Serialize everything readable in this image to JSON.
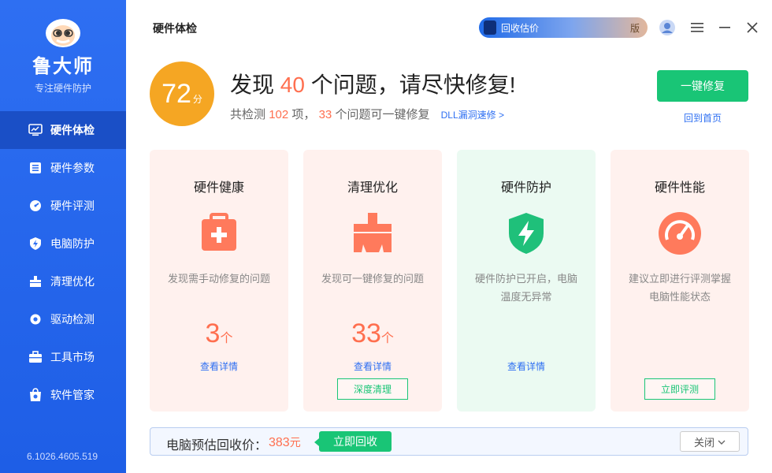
{
  "sidebar": {
    "brand_name": "鲁大师",
    "brand_slogan": "专注硬件防护",
    "items": [
      {
        "label": "硬件体检",
        "icon": "monitor-icon"
      },
      {
        "label": "硬件参数",
        "icon": "params-icon"
      },
      {
        "label": "硬件评测",
        "icon": "gauge-icon"
      },
      {
        "label": "电脑防护",
        "icon": "shield-icon"
      },
      {
        "label": "清理优化",
        "icon": "broom-icon"
      },
      {
        "label": "驱动检测",
        "icon": "gear-icon"
      },
      {
        "label": "工具市场",
        "icon": "toolbox-icon"
      },
      {
        "label": "软件管家",
        "icon": "bag-icon"
      }
    ],
    "version": "6.1026.4605.519"
  },
  "header": {
    "title": "硬件体检",
    "promo_text": "回收估价",
    "promo_tail": "版"
  },
  "summary": {
    "score": "72",
    "score_unit": "分",
    "headline_prefix": "发现",
    "headline_count": "40",
    "headline_suffix": "个问题，请尽快修复!",
    "sub_prefix": "共检测",
    "sub_total": "102",
    "sub_mid": "项，",
    "sub_fixable": "33",
    "sub_suffix": "个问题可一键修复",
    "dll_link": "DLL漏洞速修 >",
    "fix_button": "一键修复",
    "home_link": "回到首页"
  },
  "cards": [
    {
      "title": "硬件健康",
      "desc": "发现需手动修复的问题",
      "count": "3",
      "unit": "个",
      "detail": "查看详情",
      "action": ""
    },
    {
      "title": "清理优化",
      "desc": "发现可一键修复的问题",
      "count": "33",
      "unit": "个",
      "detail": "查看详情",
      "action": "深度清理"
    },
    {
      "title": "硬件防护",
      "desc": "硬件防护已开启，电脑温度无异常",
      "count": "",
      "unit": "",
      "detail": "查看详情",
      "action": ""
    },
    {
      "title": "硬件性能",
      "desc": "建议立即进行评测掌握电脑性能状态",
      "count": "",
      "unit": "",
      "detail": "",
      "action": "立即评测"
    }
  ],
  "bottom": {
    "label": "电脑预估回收价：",
    "price": "383",
    "price_unit": "元",
    "recycle_button": "立即回收",
    "close_button": "关闭"
  },
  "colors": {
    "sidebar": "#2e6ff2",
    "accent_green": "#19c576",
    "accent_orange": "#ff6f4f",
    "score_bg": "#f5a623"
  }
}
